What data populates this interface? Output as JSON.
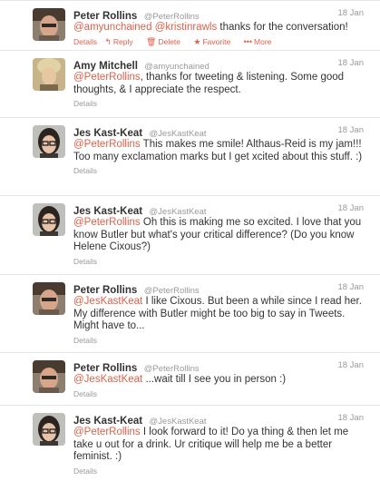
{
  "colors": {
    "mention": "#e0604a",
    "muted": "#999999",
    "divider": "#e6e6e6"
  },
  "tweets": [
    {
      "name": "Peter Rollins",
      "handle": "@PeterRollins",
      "time": "18 Jan",
      "mention": "@amyunchained @kristinrawls",
      "text": "thanks for the conversation!",
      "actions": {
        "details": "Details",
        "reply": "Reply",
        "delete": "Delete",
        "favorite": "Favorite",
        "more": "More"
      }
    },
    {
      "name": "Amy Mitchell",
      "handle": "@amyunchained",
      "time": "18 Jan",
      "mention": "@PeterRollins",
      "text": ", thanks for tweeting & listening. Some good thoughts, & I appreciate the respect.",
      "details": "Details"
    },
    {
      "name": "Jes Kast-Keat",
      "handle": "@JesKastKeat",
      "time": "18 Jan",
      "mention": "@PeterRollins",
      "text": "This makes me smile! Althaus-Reid is my jam!!! Too many exclamation marks but I get xcited about this stuff. :)",
      "details": "Details"
    },
    {
      "name": "Jes Kast-Keat",
      "handle": "@JesKastKeat",
      "time": "18 Jan",
      "mention": "@PeterRollins",
      "text": "Oh this is making me so excited. I love that you know Butler but what's your critical difference? (Do you know Helene Cixous?)",
      "details": "Details"
    },
    {
      "name": "Peter Rollins",
      "handle": "@PeterRollins",
      "time": "18 Jan",
      "mention": "@JesKastKeat",
      "text": "I like Cixous. But been a while since I read her. My difference with Butler might be too big to say in Tweets. Might have to...",
      "details": "Details"
    },
    {
      "name": "Peter Rollins",
      "handle": "@PeterRollins",
      "time": "18 Jan",
      "mention": "@JesKastKeat",
      "text": "...wait till I see you in person :)",
      "details": "Details"
    },
    {
      "name": "Jes Kast-Keat",
      "handle": "@JesKastKeat",
      "time": "18 Jan",
      "mention": "@PeterRollins",
      "text": "I look forward to it! Do ya thing & then let me take u out for a drink. Ur critique will help me be a better feminist. :)",
      "details": "Details"
    }
  ]
}
